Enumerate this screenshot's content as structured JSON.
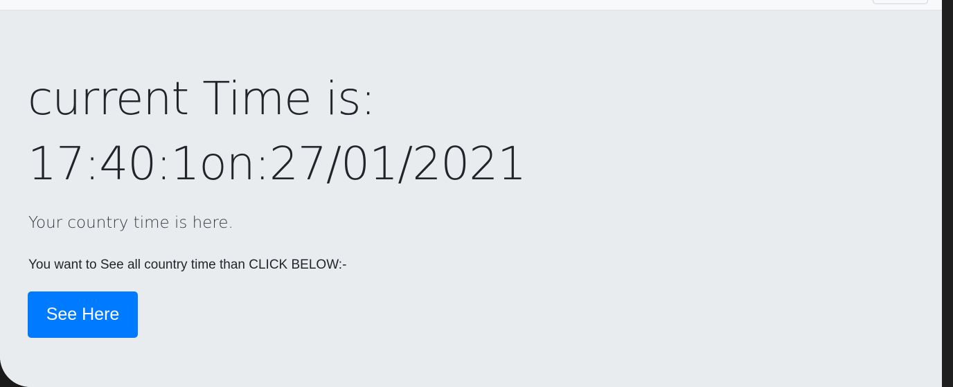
{
  "heading": {
    "line1": "current Time is:",
    "line2": "17:40:1on:27/01/2021"
  },
  "lead": "Your country time is here.",
  "info": "You want to See all country time than CLICK BELOW:-",
  "button": {
    "label": "See Here",
    "color": "#007bff"
  },
  "colors": {
    "jumbotron_bg": "#e9ecef",
    "text": "#212529"
  }
}
